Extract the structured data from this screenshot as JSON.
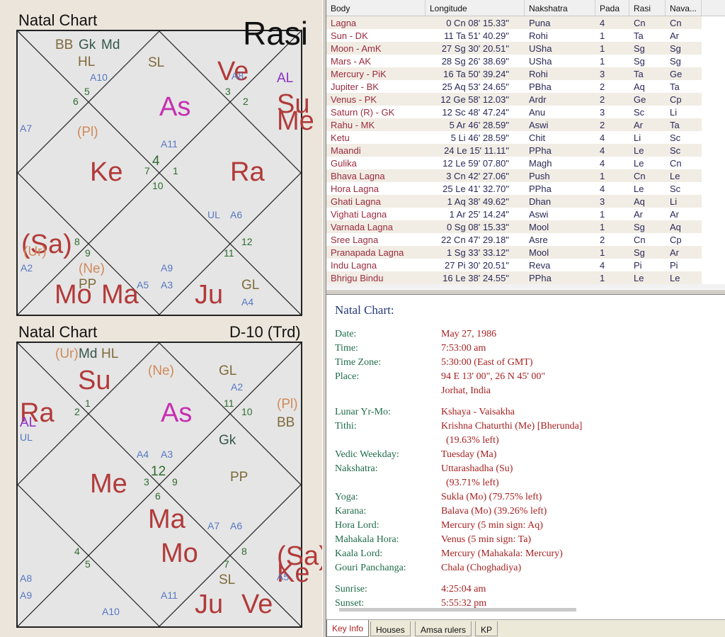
{
  "left": {
    "rasi": {
      "title": "Natal Chart",
      "name": "Rasi",
      "labels": [
        {
          "t": "BB",
          "c": "c-olive",
          "s": "med"
        },
        {
          "t": "Gk",
          "c": "c-dkgreen",
          "s": "med"
        },
        {
          "t": "Md",
          "c": "c-dkgreen",
          "s": "med"
        },
        {
          "t": "HL",
          "c": "c-olive",
          "s": "med"
        },
        {
          "t": "A10",
          "c": "c-blue",
          "s": "sm"
        },
        {
          "t": "SL",
          "c": "c-olive",
          "s": "med"
        },
        {
          "t": "Ve",
          "c": "c-red",
          "s": "big"
        },
        {
          "t": "A8",
          "c": "c-blue",
          "s": "sm"
        },
        {
          "t": "AL",
          "c": "c-purple",
          "s": "med"
        },
        {
          "t": "Su",
          "c": "c-red",
          "s": "big"
        },
        {
          "t": "Me",
          "c": "c-red",
          "s": "big"
        },
        {
          "t": "As",
          "c": "c-mag",
          "s": "big"
        },
        {
          "t": "5",
          "c": "c-green",
          "s": "num"
        },
        {
          "t": "6",
          "c": "c-green",
          "s": "num"
        },
        {
          "t": "3",
          "c": "c-green",
          "s": "num"
        },
        {
          "t": "2",
          "c": "c-green",
          "s": "num"
        },
        {
          "t": "A7",
          "c": "c-blue",
          "s": "sm"
        },
        {
          "t": "(Pl)",
          "c": "c-orange",
          "s": "med"
        },
        {
          "t": "A11",
          "c": "c-blue",
          "s": "sm"
        },
        {
          "t": "4",
          "c": "c-green",
          "s": "med"
        },
        {
          "t": "7",
          "c": "c-green",
          "s": "num"
        },
        {
          "t": "1",
          "c": "c-green",
          "s": "num"
        },
        {
          "t": "10",
          "c": "c-green",
          "s": "num"
        },
        {
          "t": "Ke",
          "c": "c-red",
          "s": "big"
        },
        {
          "t": "Ra",
          "c": "c-red",
          "s": "big"
        },
        {
          "t": "UL",
          "c": "c-blue",
          "s": "sm"
        },
        {
          "t": "A6",
          "c": "c-blue",
          "s": "sm"
        },
        {
          "t": "(Sa)",
          "c": "c-red",
          "s": "big"
        },
        {
          "t": "(Ur)",
          "c": "c-orange",
          "s": "med"
        },
        {
          "t": "8",
          "c": "c-green",
          "s": "num"
        },
        {
          "t": "9",
          "c": "c-green",
          "s": "num"
        },
        {
          "t": "12",
          "c": "c-green",
          "s": "num"
        },
        {
          "t": "11",
          "c": "c-green",
          "s": "num"
        },
        {
          "t": "A2",
          "c": "c-blue",
          "s": "sm"
        },
        {
          "t": "(Ne)",
          "c": "c-orange",
          "s": "med"
        },
        {
          "t": "PP",
          "c": "c-olive",
          "s": "med"
        },
        {
          "t": "A9",
          "c": "c-blue",
          "s": "sm"
        },
        {
          "t": "A5",
          "c": "c-blue",
          "s": "sm"
        },
        {
          "t": "A3",
          "c": "c-blue",
          "s": "sm"
        },
        {
          "t": "Mo",
          "c": "c-red",
          "s": "big"
        },
        {
          "t": "Ma",
          "c": "c-red",
          "s": "big"
        },
        {
          "t": "Ju",
          "c": "c-red",
          "s": "big"
        },
        {
          "t": "GL",
          "c": "c-olive",
          "s": "med"
        },
        {
          "t": "A4",
          "c": "c-blue",
          "s": "sm"
        }
      ]
    },
    "d10": {
      "title": "Natal Chart",
      "name": "D-10 (Trd)",
      "labels": [
        {
          "t": "(Ur)",
          "c": "c-orange",
          "s": "med"
        },
        {
          "t": "Md",
          "c": "c-dkgreen",
          "s": "med"
        },
        {
          "t": "HL",
          "c": "c-olive",
          "s": "med"
        },
        {
          "t": "Su",
          "c": "c-red",
          "s": "big"
        },
        {
          "t": "(Ne)",
          "c": "c-orange",
          "s": "med"
        },
        {
          "t": "GL",
          "c": "c-olive",
          "s": "med"
        },
        {
          "t": "A2",
          "c": "c-blue",
          "s": "sm"
        },
        {
          "t": "Ra",
          "c": "c-red",
          "s": "big"
        },
        {
          "t": "AL",
          "c": "c-purple",
          "s": "med"
        },
        {
          "t": "UL",
          "c": "c-blue",
          "s": "sm"
        },
        {
          "t": "2",
          "c": "c-green",
          "s": "num"
        },
        {
          "t": "1",
          "c": "c-green",
          "s": "num"
        },
        {
          "t": "As",
          "c": "c-mag",
          "s": "big"
        },
        {
          "t": "11",
          "c": "c-green",
          "s": "num"
        },
        {
          "t": "10",
          "c": "c-green",
          "s": "num"
        },
        {
          "t": "(Pl)",
          "c": "c-orange",
          "s": "med"
        },
        {
          "t": "BB",
          "c": "c-olive",
          "s": "med"
        },
        {
          "t": "Gk",
          "c": "c-dkgreen",
          "s": "med"
        },
        {
          "t": "A4",
          "c": "c-blue",
          "s": "sm"
        },
        {
          "t": "A3",
          "c": "c-blue",
          "s": "sm"
        },
        {
          "t": "12",
          "c": "c-green",
          "s": "med"
        },
        {
          "t": "3",
          "c": "c-green",
          "s": "num"
        },
        {
          "t": "9",
          "c": "c-green",
          "s": "num"
        },
        {
          "t": "6",
          "c": "c-green",
          "s": "num"
        },
        {
          "t": "Me",
          "c": "c-red",
          "s": "big"
        },
        {
          "t": "PP",
          "c": "c-olive",
          "s": "med"
        },
        {
          "t": "Ma",
          "c": "c-red",
          "s": "big"
        },
        {
          "t": "A7",
          "c": "c-blue",
          "s": "sm"
        },
        {
          "t": "A6",
          "c": "c-blue",
          "s": "sm"
        },
        {
          "t": "4",
          "c": "c-green",
          "s": "num"
        },
        {
          "t": "5",
          "c": "c-green",
          "s": "num"
        },
        {
          "t": "Mo",
          "c": "c-red",
          "s": "big"
        },
        {
          "t": "7",
          "c": "c-green",
          "s": "num"
        },
        {
          "t": "8",
          "c": "c-green",
          "s": "num"
        },
        {
          "t": "(Sa)",
          "c": "c-red",
          "s": "big"
        },
        {
          "t": "Ke",
          "c": "c-red",
          "s": "big"
        },
        {
          "t": "A5",
          "c": "c-blue",
          "s": "sm"
        },
        {
          "t": "A8",
          "c": "c-blue",
          "s": "sm"
        },
        {
          "t": "A9",
          "c": "c-blue",
          "s": "sm"
        },
        {
          "t": "SL",
          "c": "c-olive",
          "s": "med"
        },
        {
          "t": "A11",
          "c": "c-blue",
          "s": "sm"
        },
        {
          "t": "Ju",
          "c": "c-red",
          "s": "big"
        },
        {
          "t": "Ve",
          "c": "c-red",
          "s": "big"
        },
        {
          "t": "A10",
          "c": "c-blue",
          "s": "sm"
        }
      ]
    }
  },
  "table": {
    "columns": [
      "Body",
      "Longitude",
      "Nakshatra",
      "Pada",
      "Rasi",
      "Nava..."
    ],
    "rows": [
      [
        "Lagna",
        "0 Cn 08' 15.33\"",
        "Puna",
        "4",
        "Cn",
        "Cn"
      ],
      [
        "Sun - DK",
        "11 Ta 51' 40.29\"",
        "Rohi",
        "1",
        "Ta",
        "Ar"
      ],
      [
        "Moon - AmK",
        "27 Sg 30' 20.51\"",
        "USha",
        "1",
        "Sg",
        "Sg"
      ],
      [
        "Mars - AK",
        "28 Sg 26' 38.69\"",
        "USha",
        "1",
        "Sg",
        "Sg"
      ],
      [
        "Mercury - PiK",
        "16 Ta 50' 39.24\"",
        "Rohi",
        "3",
        "Ta",
        "Ge"
      ],
      [
        "Jupiter - BK",
        "25 Aq 53' 24.65\"",
        "PBha",
        "2",
        "Aq",
        "Ta"
      ],
      [
        "Venus - PK",
        "12 Ge 58' 12.03\"",
        "Ardr",
        "2",
        "Ge",
        "Cp"
      ],
      [
        "Saturn (R) - GK",
        "12 Sc 48' 47.24\"",
        "Anu",
        "3",
        "Sc",
        "Li"
      ],
      [
        "Rahu - MK",
        "5 Ar 46' 28.59\"",
        "Aswi",
        "2",
        "Ar",
        "Ta"
      ],
      [
        "Ketu",
        "5 Li 46' 28.59\"",
        "Chit",
        "4",
        "Li",
        "Sc"
      ],
      [
        "Maandi",
        "24 Le 15' 11.11\"",
        "PPha",
        "4",
        "Le",
        "Sc"
      ],
      [
        "Gulika",
        "12 Le 59' 07.80\"",
        "Magh",
        "4",
        "Le",
        "Cn"
      ],
      [
        "Bhava Lagna",
        "3 Cn 42' 27.06\"",
        "Push",
        "1",
        "Cn",
        "Le"
      ],
      [
        "Hora Lagna",
        "25 Le 41' 32.70\"",
        "PPha",
        "4",
        "Le",
        "Sc"
      ],
      [
        "Ghati Lagna",
        "1 Aq 38' 49.62\"",
        "Dhan",
        "3",
        "Aq",
        "Li"
      ],
      [
        "Vighati Lagna",
        "1 Ar 25' 14.24\"",
        "Aswi",
        "1",
        "Ar",
        "Ar"
      ],
      [
        "Varnada Lagna",
        "0 Sg 08' 15.33\"",
        "Mool",
        "1",
        "Sg",
        "Aq"
      ],
      [
        "Sree Lagna",
        "22 Cn 47' 29.18\"",
        "Asre",
        "2",
        "Cn",
        "Cp"
      ],
      [
        "Pranapada Lagna",
        "1 Sg 33' 33.12\"",
        "Mool",
        "1",
        "Sg",
        "Ar"
      ],
      [
        "Indu Lagna",
        "27 Pi 30' 20.51\"",
        "Reva",
        "4",
        "Pi",
        "Pi"
      ],
      [
        "Bhrigu Bindu",
        "16 Le 38' 24.55\"",
        "PPha",
        "1",
        "Le",
        "Le"
      ]
    ]
  },
  "info": {
    "title": "Natal Chart:",
    "rows": [
      {
        "k": "Date:",
        "v": "May 27, 1986"
      },
      {
        "k": "Time:",
        "v": "7:53:00 am"
      },
      {
        "k": "Time Zone:",
        "v": "5:30:00 (East of GMT)"
      },
      {
        "k": "Place:",
        "v": "94 E 13' 00\", 26 N 45' 00\""
      },
      {
        "k": "",
        "v": "Jorhat, India"
      },
      {
        "k": "Lunar Yr-Mo:",
        "v": "Kshaya - Vaisakha"
      },
      {
        "k": "Tithi:",
        "v": "Krishna Chaturthi (Me) [Bherunda]"
      },
      {
        "k": "",
        "v": "  (19.63% left)"
      },
      {
        "k": "Vedic Weekday:",
        "v": "Tuesday (Ma)"
      },
      {
        "k": "Nakshatra:",
        "v": "Uttarashadha (Su)"
      },
      {
        "k": "",
        "v": "  (93.71% left)"
      },
      {
        "k": "Yoga:",
        "v": "Sukla (Mo) (79.75% left)"
      },
      {
        "k": "Karana:",
        "v": "Balava (Mo) (39.26% left)"
      },
      {
        "k": "Hora Lord:",
        "v": "Mercury (5 min sign: Aq)"
      },
      {
        "k": "Mahakala Hora:",
        "v": "Venus (5 min sign: Ta)"
      },
      {
        "k": "Kaala Lord:",
        "v": "Mercury (Mahakala: Mercury)"
      },
      {
        "k": "Gouri Panchanga:",
        "v": "Chala (Choghadiya)"
      },
      {
        "k": "Sunrise:",
        "v": "4:25:04 am"
      },
      {
        "k": "Sunset:",
        "v": "5:55:32 pm"
      }
    ]
  },
  "tabs": [
    "Key Info",
    "Houses",
    "Amsa rulers",
    "KP"
  ],
  "active_tab": "Key Info"
}
